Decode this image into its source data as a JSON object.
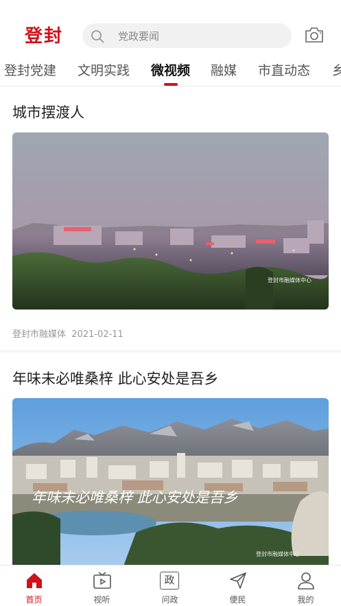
{
  "header": {
    "logo_text": "登封",
    "search_placeholder": "党政要闻",
    "icons": {
      "search": "search-icon",
      "camera": "camera-icon"
    }
  },
  "tabs": [
    {
      "label": "登封党建",
      "active": false
    },
    {
      "label": "文明实践",
      "active": false
    },
    {
      "label": "微视频",
      "active": true
    },
    {
      "label": "融媒",
      "active": false
    },
    {
      "label": "市直动态",
      "active": false
    },
    {
      "label": "乡",
      "active": false
    }
  ],
  "articles": [
    {
      "title": "城市摆渡人",
      "watermark": "登封市融媒体中心",
      "source": "登封市融媒体",
      "date": "2021-02-11"
    },
    {
      "title": "年味未必唯桑梓 此心安处是吾乡",
      "overlay_caption": "年味未必唯桑梓 此心安处是吾乡",
      "watermark": "登封市融媒体中心"
    }
  ],
  "tabbar": [
    {
      "label": "首页",
      "icon": "home-icon",
      "active": true
    },
    {
      "label": "视听",
      "icon": "tv-icon",
      "active": false
    },
    {
      "label": "问政",
      "icon": "zheng-icon",
      "glyph": "政",
      "active": false
    },
    {
      "label": "便民",
      "icon": "send-icon",
      "active": false
    },
    {
      "label": "我的",
      "icon": "person-icon",
      "active": false
    }
  ],
  "colors": {
    "accent": "#d0121b",
    "muted": "#999999",
    "divider": "#f5f5f5"
  }
}
